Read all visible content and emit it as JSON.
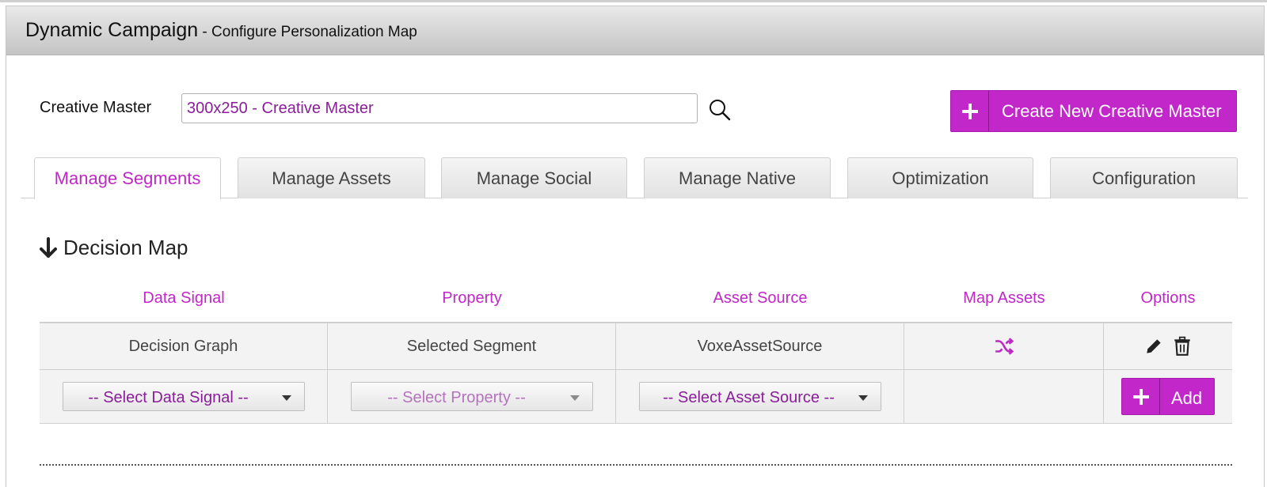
{
  "header": {
    "title": "Dynamic Campaign",
    "subtitle": " - Configure Personalization Map"
  },
  "creative_master": {
    "label": "Creative Master",
    "value": "300x250 - Creative Master",
    "search_icon": "search-icon"
  },
  "create_button": {
    "label": "Create New Creative Master",
    "icon": "plus-icon"
  },
  "tabs": [
    {
      "label": "Manage Segments",
      "active": true
    },
    {
      "label": "Manage Assets",
      "active": false
    },
    {
      "label": "Manage Social",
      "active": false
    },
    {
      "label": "Manage Native",
      "active": false
    },
    {
      "label": "Optimization",
      "active": false
    },
    {
      "label": "Configuration",
      "active": false
    }
  ],
  "decision_map": {
    "heading": "Decision Map",
    "icon": "arrow-down-icon",
    "columns": [
      "Data Signal",
      "Property",
      "Asset Source",
      "Map Assets",
      "Options"
    ],
    "rows": [
      {
        "data_signal": "Decision Graph",
        "property": "Selected Segment",
        "asset_source": "VoxeAssetSource",
        "map_assets_icon": "shuffle-icon",
        "options_icons": [
          "pencil-icon",
          "trash-icon"
        ]
      }
    ],
    "new_row": {
      "data_signal_placeholder": "-- Select Data Signal --",
      "property_placeholder": "-- Select Property --",
      "asset_source_placeholder": "-- Select Asset Source --",
      "add_label": "Add"
    }
  },
  "colors": {
    "accent": "#c227c9",
    "link_purple": "#bf27c6",
    "value_purple": "#8a1e9a"
  }
}
